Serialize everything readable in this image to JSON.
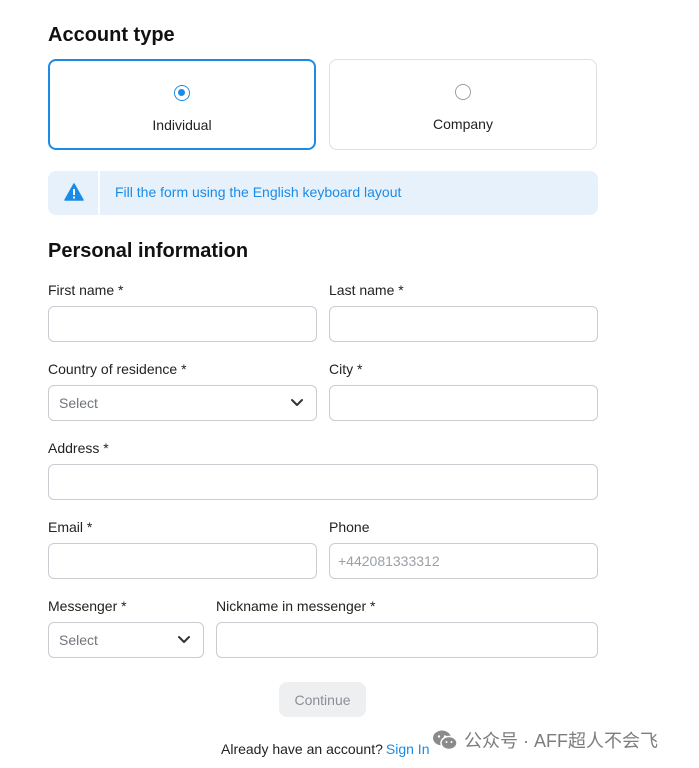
{
  "account_type": {
    "title": "Account type",
    "options": [
      {
        "label": "Individual",
        "selected": true
      },
      {
        "label": "Company",
        "selected": false
      }
    ]
  },
  "notice": {
    "text": "Fill the form using the English keyboard layout",
    "icon": "warning-icon"
  },
  "personal_info": {
    "title": "Personal information",
    "first_name": {
      "label": "First name *",
      "value": ""
    },
    "last_name": {
      "label": "Last name *",
      "value": ""
    },
    "country": {
      "label": "Country of residence *",
      "value": "Select"
    },
    "city": {
      "label": "City *",
      "value": ""
    },
    "address": {
      "label": "Address *",
      "value": ""
    },
    "email": {
      "label": "Email *",
      "value": ""
    },
    "phone": {
      "label": "Phone",
      "value": "",
      "placeholder": "+442081333312"
    },
    "messenger": {
      "label": "Messenger *",
      "value": "Select"
    },
    "nickname": {
      "label": "Nickname in messenger *",
      "value": ""
    }
  },
  "actions": {
    "continue_label": "Continue",
    "signin_prompt": "Already have an account?",
    "signin_link": "Sign In"
  },
  "watermark": {
    "text": "公众号 · AFF超人不会飞",
    "icon": "wechat-icon"
  },
  "colors": {
    "accent": "#1a8ce8",
    "notice_bg": "#e6f1fc",
    "border": "#c9ccd1",
    "button_disabled_bg": "#eeeff1"
  }
}
